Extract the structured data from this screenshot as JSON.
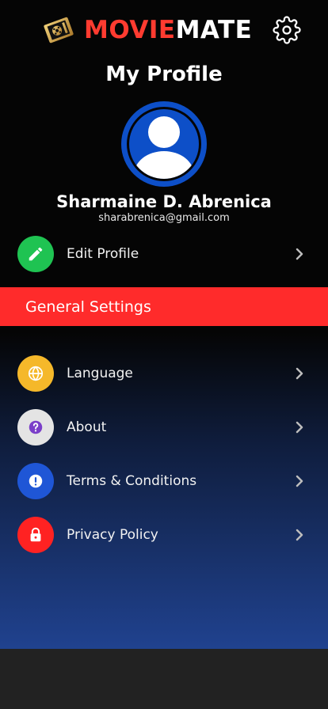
{
  "header": {
    "brand_part1": "MOVIE",
    "brand_part2": "MATE",
    "logo_icon": "movie-ticket-logo-icon",
    "settings_icon": "gear-icon"
  },
  "page_title": "My Profile",
  "user": {
    "name": "Sharmaine D. Abrenica",
    "email": "sharabrenica@gmail.com",
    "avatar_icon": "user-avatar-icon"
  },
  "edit_profile": {
    "label": "Edit Profile",
    "icon": "pencil-icon",
    "color": "#1fc352"
  },
  "general_settings": {
    "title": "General Settings",
    "color": "#ff2b2b"
  },
  "settings_items": [
    {
      "label": "Language",
      "icon": "globe-icon",
      "color": "#f5b82a"
    },
    {
      "label": "About",
      "icon": "question-icon",
      "color": "#e4e4e4"
    },
    {
      "label": "Terms & Conditions",
      "icon": "exclamation-icon",
      "color": "#1f56d6"
    },
    {
      "label": "Privacy Policy",
      "icon": "lock-icon",
      "color": "#ff2222"
    }
  ],
  "colors": {
    "accent_red": "#ff3b30",
    "background_top": "#050505",
    "background_bottom": "#20428f"
  }
}
